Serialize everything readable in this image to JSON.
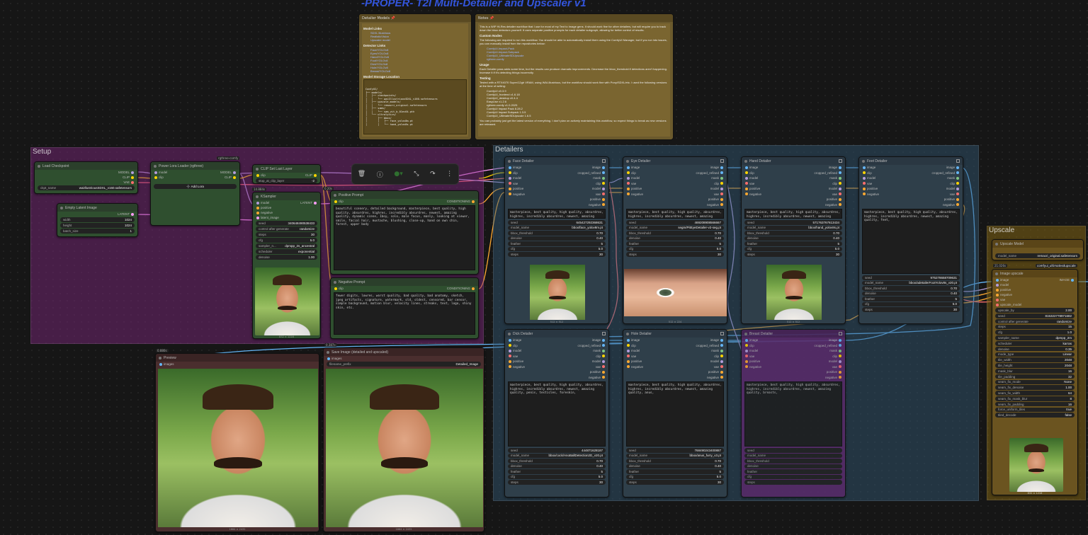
{
  "title": "-PROPER- T2I Multi-Detailer and Upscaler v1",
  "groups": {
    "setup": "Setup",
    "detailers": "Detailers",
    "upscale": "Upscale"
  },
  "notes1": {
    "title": "Detailer Models 📌",
    "h1": "Model Links",
    "links1": [
      "SDXL Illustrious",
      "RealisticVision",
      "Upscaler model"
    ],
    "h2": "Detector Links",
    "links2": [
      "Face/YOLOv8",
      "Eyes/YOLOv8",
      "Hand/YOLOv8",
      "Foot/YOLOv8",
      "Dick/YOLOv8",
      "Hole/YOLOv8",
      "Breast/YOLOv8"
    ],
    "h3": "Model Storage Location",
    "tree": [
      "ComfyUI/",
      "├── models/",
      "│   ├── checkpoints/",
      "│   │   └── waiIllustriousSDXL_v160.safetensors",
      "│   ├── upscale_models/",
      "│   │   └── remacri_original.safetensors",
      "│   ├── sams/",
      "│   │   └── sam_vit_b_01ec64.pth",
      "│   └── ultralytics/",
      "│       ├── bbox/",
      "│       │   ├── face_yolov8m.pt",
      "│       │   └── hand_yolov8s.pt"
    ]
  },
  "notes2": {
    "title": "Notes 📌",
    "p1": "This is a WIP Hi-Res detailer workflow that I use for most of my Text to Image gens. It should work fine for other detailers, but will require you to track down the bbox detectors yourself. It uses separate positive prompts for each detailer subgraph, allowing for better control of results.",
    "h1": "Custom Nodes",
    "p2": "The following are required to run this workflow. You should be able to automatically install them using the ComfyUI Manager, but if you run into issues, you can manually install from the repositories below:",
    "links": [
      "ComfyUI-Impact-Pack",
      "ComfyUI-Impact-Subpack",
      "ComfyUI_UltimateSDUpscale",
      "rgthree-comfy"
    ],
    "h2": "Usage",
    "p3": "Each Detailer pass adds some time, but the results can produce dramatic improvements. Decrease the bbox_threshold if detections aren't happening. Increase it if it's detecting things incorrectly.",
    "h3": "Testing",
    "p4": "Tested with a RTX4070 Super/12gb VRAM, using WAI-Illustrious, but the workflow should work fine with Pony/SDXL/etc. I used the following versions at the time of writing:",
    "versions": [
      "ComfyUI v0.3.9",
      "ComfyUI_frontend v1.6.18",
      "ComfyUI_desktop v0.4.4",
      "EasyUse v1.2.6",
      "rgthree-comfy v1.0.2025",
      "ComfyUI Impact Pack 8.28.2",
      "ComfyUI Impact Subpack 1.3.5",
      "ComfyUI_UltimateSDUpscale 1.6.5"
    ],
    "p5": "You can probably just get the latest version of everything. I don't plan on actively maintaining this workflow, so expect things to break as new versions are released."
  },
  "checkpoint": {
    "title": "Load Checkpoint",
    "outs": [
      "MODEL",
      "CLIP",
      "VAE"
    ],
    "w_label": "ckpt_name",
    "w_val": "waiIllustriousSDXL_v160.safetensors"
  },
  "lora": {
    "badge": "rgthree-comfy",
    "title": "Power Lora Loader (rgthree)",
    "ins": [
      "model",
      "clip"
    ],
    "outs": [
      "MODEL",
      "CLIP"
    ],
    "add": "➕ Add Lora"
  },
  "cliplayer": {
    "title": "CLIP Set Last Layer",
    "in": "clip",
    "out": "CLIP",
    "w_label": "stop_at_clip_layer",
    "w_val": "-2"
  },
  "latent": {
    "title": "Empty Latent Image",
    "out": "LATENT",
    "widgets": [
      [
        "width",
        "1024"
      ],
      [
        "height",
        "1024"
      ],
      [
        "batch_size",
        "1"
      ]
    ]
  },
  "ksampler": {
    "badge": "14.884s",
    "title": "KSampler",
    "ins": [
      "model",
      "positive",
      "negative",
      "latent_image"
    ],
    "out": "LATENT",
    "widgets": [
      [
        "seed",
        "340648490538433"
      ],
      [
        "control after generate",
        "randomize"
      ],
      [
        "steps",
        "30"
      ],
      [
        "cfg",
        "5.0"
      ],
      [
        "sampler_n...",
        "dpmpp_2s_ancestral"
      ],
      [
        "scheduler",
        "exponential"
      ],
      [
        "denoise",
        "1.00"
      ]
    ],
    "caption": "832 × 1216"
  },
  "pos": {
    "badge": "0.20s",
    "title": "Positive Prompt",
    "in": "clip",
    "out": "CONDITIONING",
    "text": "beautiful scenery, detailed background, masterpiece, best quality, high quality, absurdres, highres, incredibly absurdres, newest, amazing quality, dynamic scene, 1boy, solo, male focus, manly, looking at viewer, smile, facial hair, mustache, blushing, close-up, hand on own chin, forest, upper body"
  },
  "neg": {
    "title": "Negative Prompt",
    "in": "clip",
    "out": "CONDITIONING",
    "text": "fewer digits, lowres, worst quality, bad quality, bad anatomy, sketch, jpeg artifacts, signature, watermark, old, oldest, censored, bar censor, simple background, motion blur, velocity lines, streaks, text, logo, shiny skin, etc."
  },
  "preview": {
    "badge": "0.880s",
    "title": "Preview",
    "in": "images",
    "caption": "1664 × 2432"
  },
  "save": {
    "badge": "0.387s",
    "title": "Save Image (detailed and upscaled)",
    "in": "images",
    "w_label": "filename_prefix",
    "w_val": "Detailed_Image",
    "caption": "1664 × 2432"
  },
  "det_ins": [
    "image",
    "clip",
    "model",
    "vae",
    "positive",
    "negative"
  ],
  "det_outs": [
    "image",
    "cropped_refined",
    "mask",
    "clip",
    "model",
    "vae",
    "positive",
    "negative"
  ],
  "detailers": [
    {
      "title": "Face Detailer",
      "text": "masterpiece, best quality, high quality, absurdres, highres, incredibly absurdres, newest, amazing quality, face, mustache, smiling",
      "widgets": [
        [
          "seed",
          "645427292368631"
        ],
        [
          "model_name",
          "bbox/face_yolov8m.pt"
        ],
        [
          "bbox_threshold",
          "0.70"
        ],
        [
          "denoise",
          "0.40"
        ],
        [
          "feather",
          "5"
        ],
        [
          "cfg",
          "5.0"
        ],
        [
          "steps",
          "30"
        ]
      ],
      "caption": "512 × 512"
    },
    {
      "title": "Eye Detailer",
      "text": "masterpiece, best quality, high quality, absurdres, highres, incredibly absurdres, newest, amazing quality, green eyes",
      "widgets": [
        [
          "seed",
          "469208908566667"
        ],
        [
          "model_name",
          "segm/PitEyeDetailer-v2-seg.pt"
        ],
        [
          "bbox_threshold",
          "0.70"
        ],
        [
          "denoise",
          "0.40"
        ],
        [
          "feather",
          "5"
        ],
        [
          "cfg",
          "5.0"
        ],
        [
          "steps",
          "30"
        ]
      ],
      "caption": "512 × 224"
    },
    {
      "title": "Hand Detailer",
      "text": "masterpiece, best quality, high quality, absurdres, highres, incredibly absurdres, newest, amazing quality, hand,",
      "widgets": [
        [
          "seed",
          "571763767613434"
        ],
        [
          "model_name",
          "bbox/hand_yolov8s.pt"
        ],
        [
          "bbox_threshold",
          "0.70"
        ],
        [
          "denoise",
          "0.40"
        ],
        [
          "feather",
          "5"
        ],
        [
          "cfg",
          "5.0"
        ],
        [
          "steps",
          "30"
        ]
      ],
      "caption": "512 × 512"
    },
    {
      "title": "Feet Detailer",
      "text": "masterpiece, best quality, high quality, absurdres, highres, incredibly absurdres, newest, amazing quality, feet,",
      "widgets": [
        [
          "seed",
          "975278658709631"
        ],
        [
          "model_name",
          "bbox/adetailerFootYolov8s_v20.pt"
        ],
        [
          "bbox_threshold",
          "0.70"
        ],
        [
          "denoise",
          "0.40"
        ],
        [
          "feather",
          "5"
        ],
        [
          "cfg",
          "5.0"
        ],
        [
          "steps",
          "30"
        ]
      ]
    },
    {
      "title": "Dick Detailer",
      "text": "masterpiece, best quality, high quality, absurdres, highres, incredibly absurdres, newest, amazing quality, penis, testicles, foreskin,",
      "widgets": [
        [
          "seed",
          "444871628187"
        ],
        [
          "model_name",
          "bbox/cock/AnoBallDetection2D_v20.pt"
        ],
        [
          "bbox_threshold",
          "0.70"
        ],
        [
          "denoise",
          "0.40"
        ],
        [
          "feather",
          "5"
        ],
        [
          "cfg",
          "5.0"
        ],
        [
          "steps",
          "30"
        ]
      ]
    },
    {
      "title": "Hole Detailer",
      "text": "masterpiece, best quality, high quality, absurdres, highres, incredibly absurdres, newest, amazing quality, anus,",
      "widgets": [
        [
          "seed",
          "768490243400887"
        ],
        [
          "model_name",
          "bbox/anus_furry_v3.pt"
        ],
        [
          "bbox_threshold",
          "0.70"
        ],
        [
          "denoise",
          "0.40"
        ],
        [
          "feather",
          "5"
        ],
        [
          "cfg",
          "5.0"
        ],
        [
          "steps",
          "30"
        ]
      ]
    },
    {
      "title": "Breast Detailer",
      "text": "masterpiece, best quality, high quality, absurdres, highres, incredibly absurdres, newest, amazing quality, breasts,",
      "widgets": [
        [
          "seed",
          "",
          ""
        ],
        [
          "model_name",
          ""
        ],
        [
          "bbox_threshold",
          ""
        ],
        [
          "denoise",
          ""
        ],
        [
          "feather",
          ""
        ],
        [
          "cfg",
          ""
        ],
        [
          "steps",
          ""
        ]
      ]
    }
  ],
  "upmodel": {
    "title": "Upscale Model",
    "w_label": "model_name",
    "w_val": "remacri_original.safetensors"
  },
  "upscale": {
    "badge": "21.026s",
    "badge2": "comfyui_ultimatesdupscale",
    "title": "Image upscale",
    "ins": [
      "image",
      "model",
      "positive",
      "negative",
      "vae",
      "upscale_model"
    ],
    "out": "IMAGE",
    "widgets": [
      [
        "upscale_by",
        "2.00"
      ],
      [
        "seed",
        "815322778971682"
      ],
      [
        "control after generate",
        "randomize"
      ],
      [
        "steps",
        "15"
      ],
      [
        "cfg",
        "1.0"
      ],
      [
        "sampler_name",
        "dpmpp_2m"
      ],
      [
        "scheduler",
        "karras"
      ],
      [
        "denoise",
        "0.35"
      ],
      [
        "mode_type",
        "Linear"
      ],
      [
        "tile_width",
        "2048"
      ],
      [
        "tile_height",
        "2048"
      ],
      [
        "mask_blur",
        "16"
      ],
      [
        "tile_padding",
        "32"
      ],
      [
        "seam_fix_mode",
        "None"
      ],
      [
        "seam_fix_denoise",
        "1.00"
      ],
      [
        "seam_fix_width",
        "64"
      ],
      [
        "seam_fix_mask_blur",
        "8"
      ],
      [
        "seam_fix_padding",
        "16"
      ],
      [
        "force_uniform_tiles",
        "true"
      ],
      [
        "tiled_decode",
        "false"
      ]
    ],
    "caption": "832 × 1216"
  },
  "colors": {
    "model": "#b39ddb",
    "clip": "#ffd500",
    "vae": "#ff6e6e",
    "cond": "#ffa931",
    "latent": "#ff9cf9",
    "image": "#64b5f6"
  }
}
